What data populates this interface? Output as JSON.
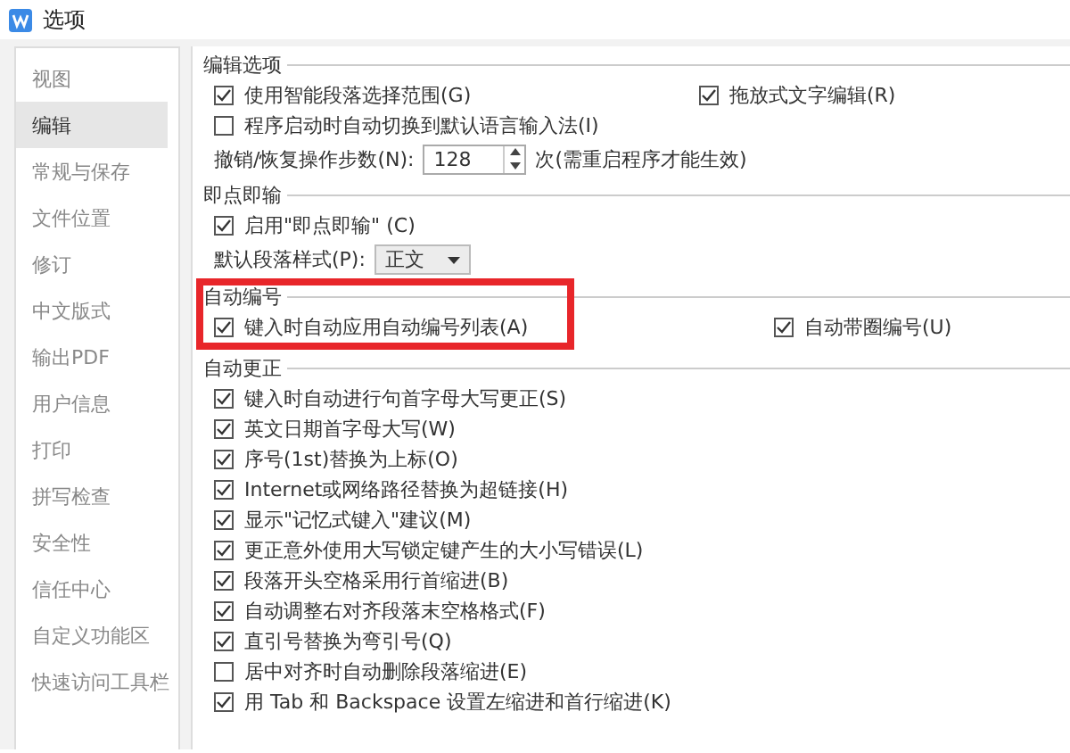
{
  "window": {
    "title": "选项"
  },
  "sidebar": {
    "items": [
      {
        "label": "视图",
        "selected": false
      },
      {
        "label": "编辑",
        "selected": true
      },
      {
        "label": "常规与保存",
        "selected": false
      },
      {
        "label": "文件位置",
        "selected": false
      },
      {
        "label": "修订",
        "selected": false
      },
      {
        "label": "中文版式",
        "selected": false
      },
      {
        "label": "输出PDF",
        "selected": false
      },
      {
        "label": "用户信息",
        "selected": false
      },
      {
        "label": "打印",
        "selected": false
      },
      {
        "label": "拼写检查",
        "selected": false
      },
      {
        "label": "安全性",
        "selected": false
      },
      {
        "label": "信任中心",
        "selected": false
      },
      {
        "label": "自定义功能区",
        "selected": false
      },
      {
        "label": "快速访问工具栏",
        "selected": false
      }
    ]
  },
  "sections": [
    {
      "title": "编辑选项",
      "rows": [
        {
          "kind": "checks",
          "items": [
            {
              "label": "使用智能段落选择范围(G)",
              "checked": true
            },
            {
              "label": "拖放式文字编辑(R)",
              "checked": true
            }
          ]
        },
        {
          "kind": "checks",
          "items": [
            {
              "label": "程序启动时自动切换到默认语言输入法(I)",
              "checked": false
            }
          ]
        },
        {
          "kind": "spinner",
          "label": "撤销/恢复操作步数(N):",
          "value": "128",
          "suffix": "次(需重启程序才能生效)"
        }
      ]
    },
    {
      "title": "即点即输",
      "rows": [
        {
          "kind": "checks",
          "items": [
            {
              "label": "启用\"即点即输\" (C)",
              "checked": true
            }
          ]
        },
        {
          "kind": "dropdown",
          "label": "默认段落样式(P):",
          "value": "正文"
        }
      ]
    },
    {
      "title": "自动编号",
      "rows": [
        {
          "kind": "checks",
          "highlighted": true,
          "items": [
            {
              "label": "键入时自动应用自动编号列表(A)",
              "checked": true
            },
            {
              "label": "自动带圈编号(U)",
              "checked": true
            }
          ]
        }
      ]
    },
    {
      "title": "自动更正",
      "rows": [
        {
          "kind": "checks",
          "items": [
            {
              "label": "键入时自动进行句首字母大写更正(S)",
              "checked": true
            }
          ]
        },
        {
          "kind": "checks",
          "items": [
            {
              "label": "英文日期首字母大写(W)",
              "checked": true
            }
          ]
        },
        {
          "kind": "checks",
          "items": [
            {
              "label": "序号(1st)替换为上标(O)",
              "checked": true
            }
          ]
        },
        {
          "kind": "checks",
          "items": [
            {
              "label": "Internet或网络路径替换为超链接(H)",
              "checked": true
            }
          ]
        },
        {
          "kind": "checks",
          "items": [
            {
              "label": "显示\"记忆式键入\"建议(M)",
              "checked": true
            }
          ]
        },
        {
          "kind": "checks",
          "items": [
            {
              "label": "更正意外使用大写锁定键产生的大小写错误(L)",
              "checked": true
            }
          ]
        },
        {
          "kind": "checks",
          "items": [
            {
              "label": "段落开头空格采用行首缩进(B)",
              "checked": true
            }
          ]
        },
        {
          "kind": "checks",
          "items": [
            {
              "label": "自动调整右对齐段落末空格格式(F)",
              "checked": true
            }
          ]
        },
        {
          "kind": "checks",
          "items": [
            {
              "label": "直引号替换为弯引号(Q)",
              "checked": true
            }
          ]
        },
        {
          "kind": "checks",
          "items": [
            {
              "label": "居中对齐时自动删除段落缩进(E)",
              "checked": false
            }
          ]
        },
        {
          "kind": "checks",
          "items": [
            {
              "label": "用 Tab 和 Backspace 设置左缩进和首行缩进(K)",
              "checked": true
            }
          ]
        }
      ]
    }
  ]
}
